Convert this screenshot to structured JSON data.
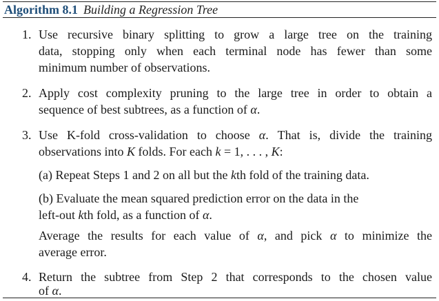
{
  "algorithm": {
    "label": "Algorithm 8.1",
    "title": "Building a Regression Tree"
  },
  "steps": {
    "s1": {
      "number": "1.",
      "l1": "Use recursive binary splitting to grow a large tree on the training",
      "l2": "data, stopping only when each terminal node has fewer than some",
      "l3": "minimum number of observations."
    },
    "s2": {
      "number": "2.",
      "l1": "Apply cost complexity pruning to the large tree in order to obtain a",
      "l2a": "sequence of best subtrees, as a function of ",
      "alpha": "α",
      "l2b": "."
    },
    "s3": {
      "number": "3.",
      "l1a": "Use K-fold cross-validation to choose ",
      "alpha": "α",
      "l1b": ". That is, divide the training",
      "l2a": "observations into ",
      "K": "K",
      "l2b": " folds. For each ",
      "k": "k",
      "l2c": " = 1, . . . , ",
      "K2": "K",
      "l2d": ":",
      "a": {
        "label": "(a)",
        "texta": "Repeat Steps 1 and 2 on all but the ",
        "k": "k",
        "textb": "th fold of the training data."
      },
      "b": {
        "label": "(b)",
        "l1": "Evaluate the mean squared prediction error on the data in the",
        "l2a": "left-out ",
        "k": "k",
        "l2b": "th fold, as a function of ",
        "alpha": "α",
        "l2c": "."
      },
      "avg": {
        "l1a": "Average the results for each value of ",
        "alpha1": "α",
        "l1b": ", and pick ",
        "alpha2": "α",
        "l1c": " to minimize the",
        "l2": "average error."
      }
    },
    "s4": {
      "number": "4.",
      "l1": "Return the subtree from Step 2 that corresponds to the chosen value",
      "l2a": "of ",
      "alpha": "α",
      "l2b": "."
    }
  }
}
